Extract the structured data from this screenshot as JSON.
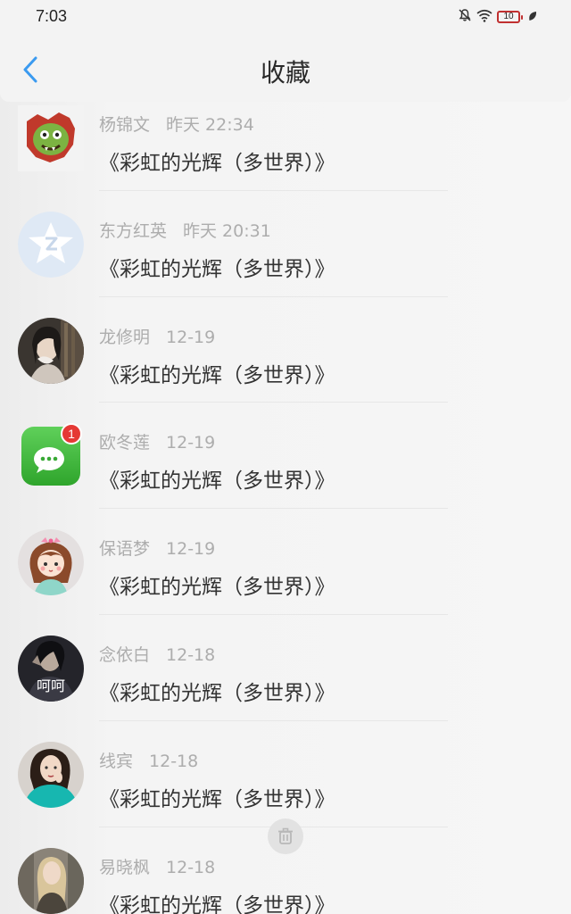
{
  "status_bar": {
    "time": "7:03",
    "battery": "10",
    "icons": [
      "mute-bell-icon",
      "wifi-icon",
      "battery-icon",
      "leaf-icon"
    ]
  },
  "header": {
    "title": "收藏",
    "back_icon": "chevron-left-icon"
  },
  "colors": {
    "accent": "#3a9af0",
    "name_text": "#adadad",
    "message_text": "#333333",
    "badge": "#e53935"
  },
  "favorites": [
    {
      "name": "杨锦文",
      "time": "昨天 22:34",
      "message": "《彩虹的光辉（多世界）》",
      "avatar": "cartoon-monster-avatar"
    },
    {
      "name": "东方红英",
      "time": "昨天 20:31",
      "message": "《彩虹的光辉（多世界）》",
      "avatar": "qq-star-avatar"
    },
    {
      "name": "龙修明",
      "time": "12-19",
      "message": "《彩虹的光辉（多世界）》",
      "avatar": "photo-avatar"
    },
    {
      "name": "欧冬莲",
      "time": "12-19",
      "message": "《彩虹的光辉（多世界）》",
      "avatar": "wechat-avatar",
      "badge": "1"
    },
    {
      "name": "保语梦",
      "time": "12-19",
      "message": "《彩虹的光辉（多世界）》",
      "avatar": "cartoon-girl-avatar"
    },
    {
      "name": "念依白",
      "time": "12-18",
      "message": "《彩虹的光辉（多世界）》",
      "avatar": "photo-avatar",
      "avatar_text": "呵呵"
    },
    {
      "name": "线宾",
      "time": "12-18",
      "message": "《彩虹的光辉（多世界）》",
      "avatar": "photo-avatar"
    },
    {
      "name": "易晓枫",
      "time": "12-18",
      "message": "《彩虹的光辉（多世界）》",
      "avatar": "photo-avatar"
    }
  ],
  "delete_button": {
    "icon": "trash-icon"
  }
}
